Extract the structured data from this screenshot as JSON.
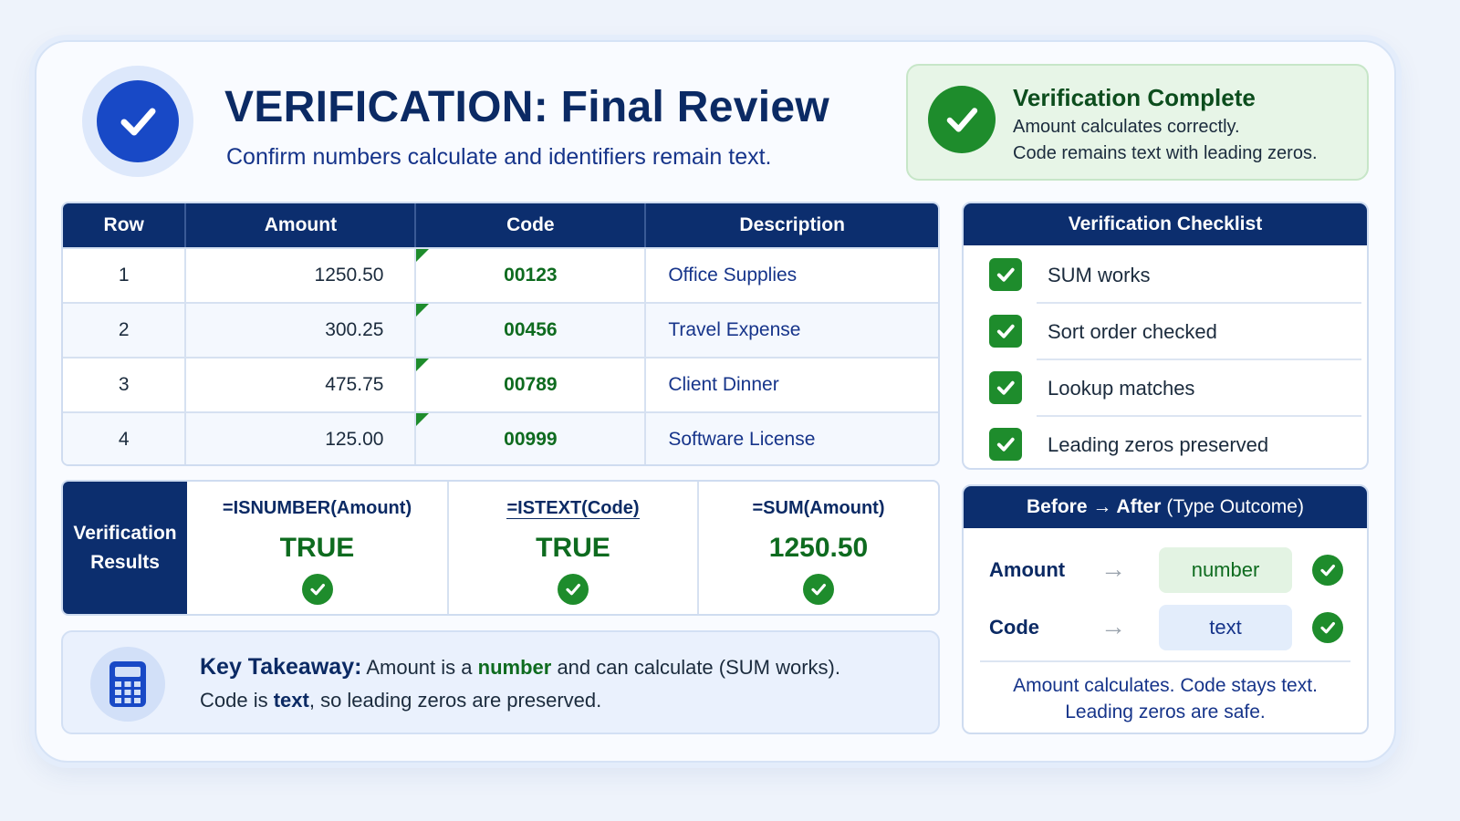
{
  "header": {
    "title": "VERIFICATION: Final Review",
    "subtitle": "Confirm numbers calculate and identifiers remain text.",
    "badge_icon": "check-circle-icon"
  },
  "status": {
    "title": "Verification Complete",
    "line1": "Amount calculates correctly.",
    "line2": "Code remains text with leading zeros."
  },
  "table": {
    "headers": [
      "Row",
      "Amount",
      "Code",
      "Description"
    ],
    "rows": [
      {
        "row": "1",
        "amount": "1250.50",
        "code": "00123",
        "description": "Office Supplies"
      },
      {
        "row": "2",
        "amount": "300.25",
        "code": "00456",
        "description": "Travel Expense"
      },
      {
        "row": "3",
        "amount": "475.75",
        "code": "00789",
        "description": "Client Dinner"
      },
      {
        "row": "4",
        "amount": "125.00",
        "code": "00999",
        "description": "Software License"
      }
    ]
  },
  "results": {
    "label_line1": "Verification",
    "label_line2": "Results",
    "items": [
      {
        "formula": "=ISNUMBER(Amount)",
        "value": "TRUE"
      },
      {
        "formula": "=ISTEXT(Code)",
        "value": "TRUE"
      },
      {
        "formula": "=SUM(Amount)",
        "value": "1250.50"
      }
    ]
  },
  "takeaway": {
    "label": "Key Takeaway:",
    "l1_a": "Amount is a",
    "l1_num": "number",
    "l1_b": "and can calculate (SUM works).",
    "l2_a": "Code is",
    "l2_txt": "text",
    "l2_b": ", so leading zeros are preserved.",
    "icon": "calculator-icon"
  },
  "checklist": {
    "title": "Verification Checklist",
    "items": [
      "SUM works",
      "Sort order checked",
      "Lookup matches",
      "Leading zeros preserved"
    ]
  },
  "before_after": {
    "title_bold": "Before → After",
    "title_light": "(Type Outcome)",
    "rows": [
      {
        "name": "Amount",
        "arrow": "→",
        "type": "number"
      },
      {
        "name": "Code",
        "arrow": "→",
        "type": "text"
      }
    ],
    "footer_line1": "Amount calculates. Code stays text.",
    "footer_line2": "Leading zeros are safe."
  },
  "colors": {
    "navy": "#0c2e6e",
    "accent_blue": "#1849c6",
    "success_green": "#1e8c2c"
  }
}
